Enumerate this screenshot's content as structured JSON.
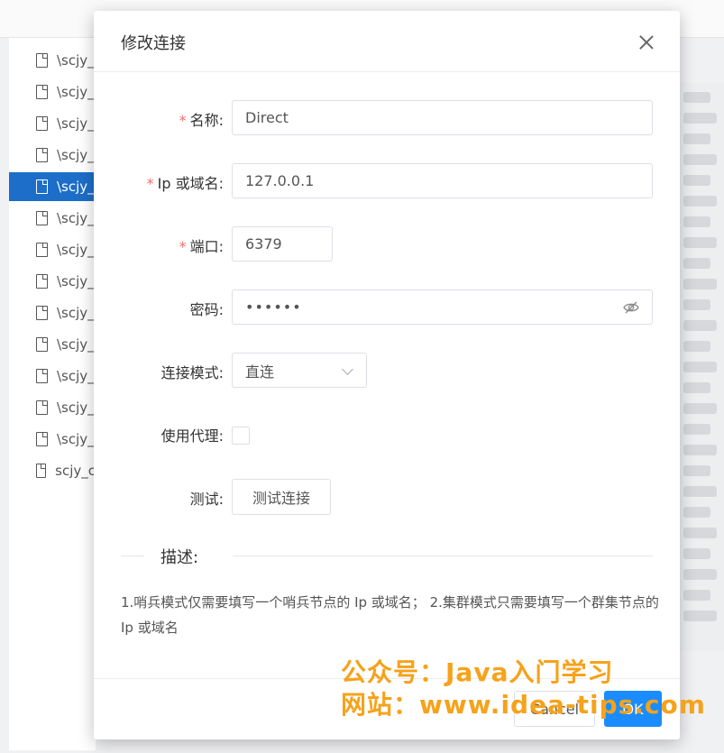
{
  "background": {
    "file_items": [
      "\\scjy_",
      "\\scjy_",
      "\\scjy_",
      "\\scjy_",
      "\\scjy_",
      "\\scjy_",
      "\\scjy_",
      "\\scjy_",
      "\\scjy_",
      "\\scjy_",
      "\\scjy_",
      "\\scjy_",
      "\\scjy_",
      "scjy_c"
    ],
    "selected_index": 4,
    "accent_color": "#1c6ec9"
  },
  "modal": {
    "title": "修改连接",
    "close_icon": "close-icon",
    "fields": {
      "name": {
        "label": "名称:",
        "value": "Direct",
        "required": true
      },
      "host": {
        "label": "Ip 或域名:",
        "value": "127.0.0.1",
        "required": true
      },
      "port": {
        "label": "端口:",
        "value": "6379",
        "required": true
      },
      "password": {
        "label": "密码:",
        "value": "••••••",
        "icon": "eye-off-icon"
      },
      "mode": {
        "label": "连接模式:",
        "value": "直连"
      },
      "proxy": {
        "label": "使用代理:",
        "checked": false
      },
      "test": {
        "label": "测试:",
        "button": "测试连接"
      }
    },
    "divider": "描述:",
    "description": "1.哨兵模式仅需要填写一个哨兵节点的 Ip 或域名； 2.集群模式只需要填写一个群集节点的 Ip 或域名",
    "footer": {
      "cancel": "Cancel",
      "ok": "OK"
    }
  },
  "watermark": {
    "line1": "公众号：Java入门学习",
    "line2": "网站：www.idea-tips.com"
  }
}
